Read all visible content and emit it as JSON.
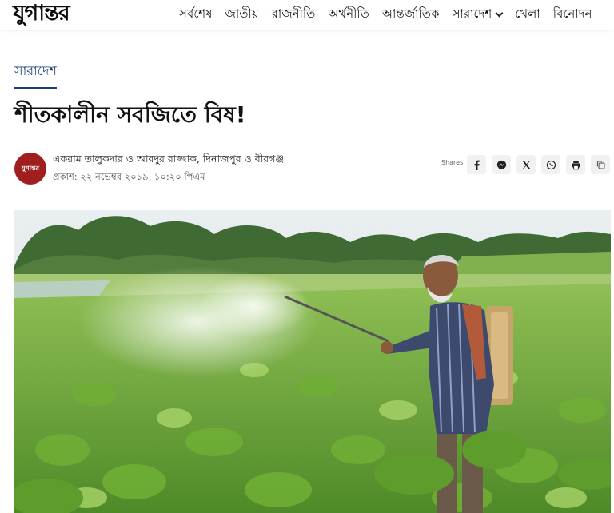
{
  "header": {
    "logo_text": "যুগান্তর",
    "nav": [
      {
        "label": "সর্বশেষ"
      },
      {
        "label": "জাতীয়"
      },
      {
        "label": "রাজনীতি"
      },
      {
        "label": "অর্থনীতি"
      },
      {
        "label": "আন্তর্জাতিক"
      },
      {
        "label": "সারাদেশ",
        "has_dropdown": true
      },
      {
        "label": "খেলা"
      },
      {
        "label": "বিনোদন"
      }
    ]
  },
  "article": {
    "category": "সারাদেশ",
    "headline": "শীতকালীন সবজিতে বিষ!",
    "author_avatar_text": "যুগান্তর",
    "byline": "একরাম তালুকদার ও আবদুর রাজ্জাক, দিনাজপুর ও বীরগঞ্জ",
    "published": "প্রকাশ: ২২ নভেম্বর ২০১৯, ১০:২০ পিএম"
  },
  "share": {
    "label": "Shares",
    "buttons": [
      {
        "icon": "facebook-icon"
      },
      {
        "icon": "messenger-icon"
      },
      {
        "icon": "x-icon"
      },
      {
        "icon": "whatsapp-icon"
      },
      {
        "icon": "print-icon"
      },
      {
        "icon": "copy-link-icon"
      }
    ]
  },
  "colors": {
    "accent": "#1a3e7a",
    "avatar_bg": "#a01e1e"
  }
}
